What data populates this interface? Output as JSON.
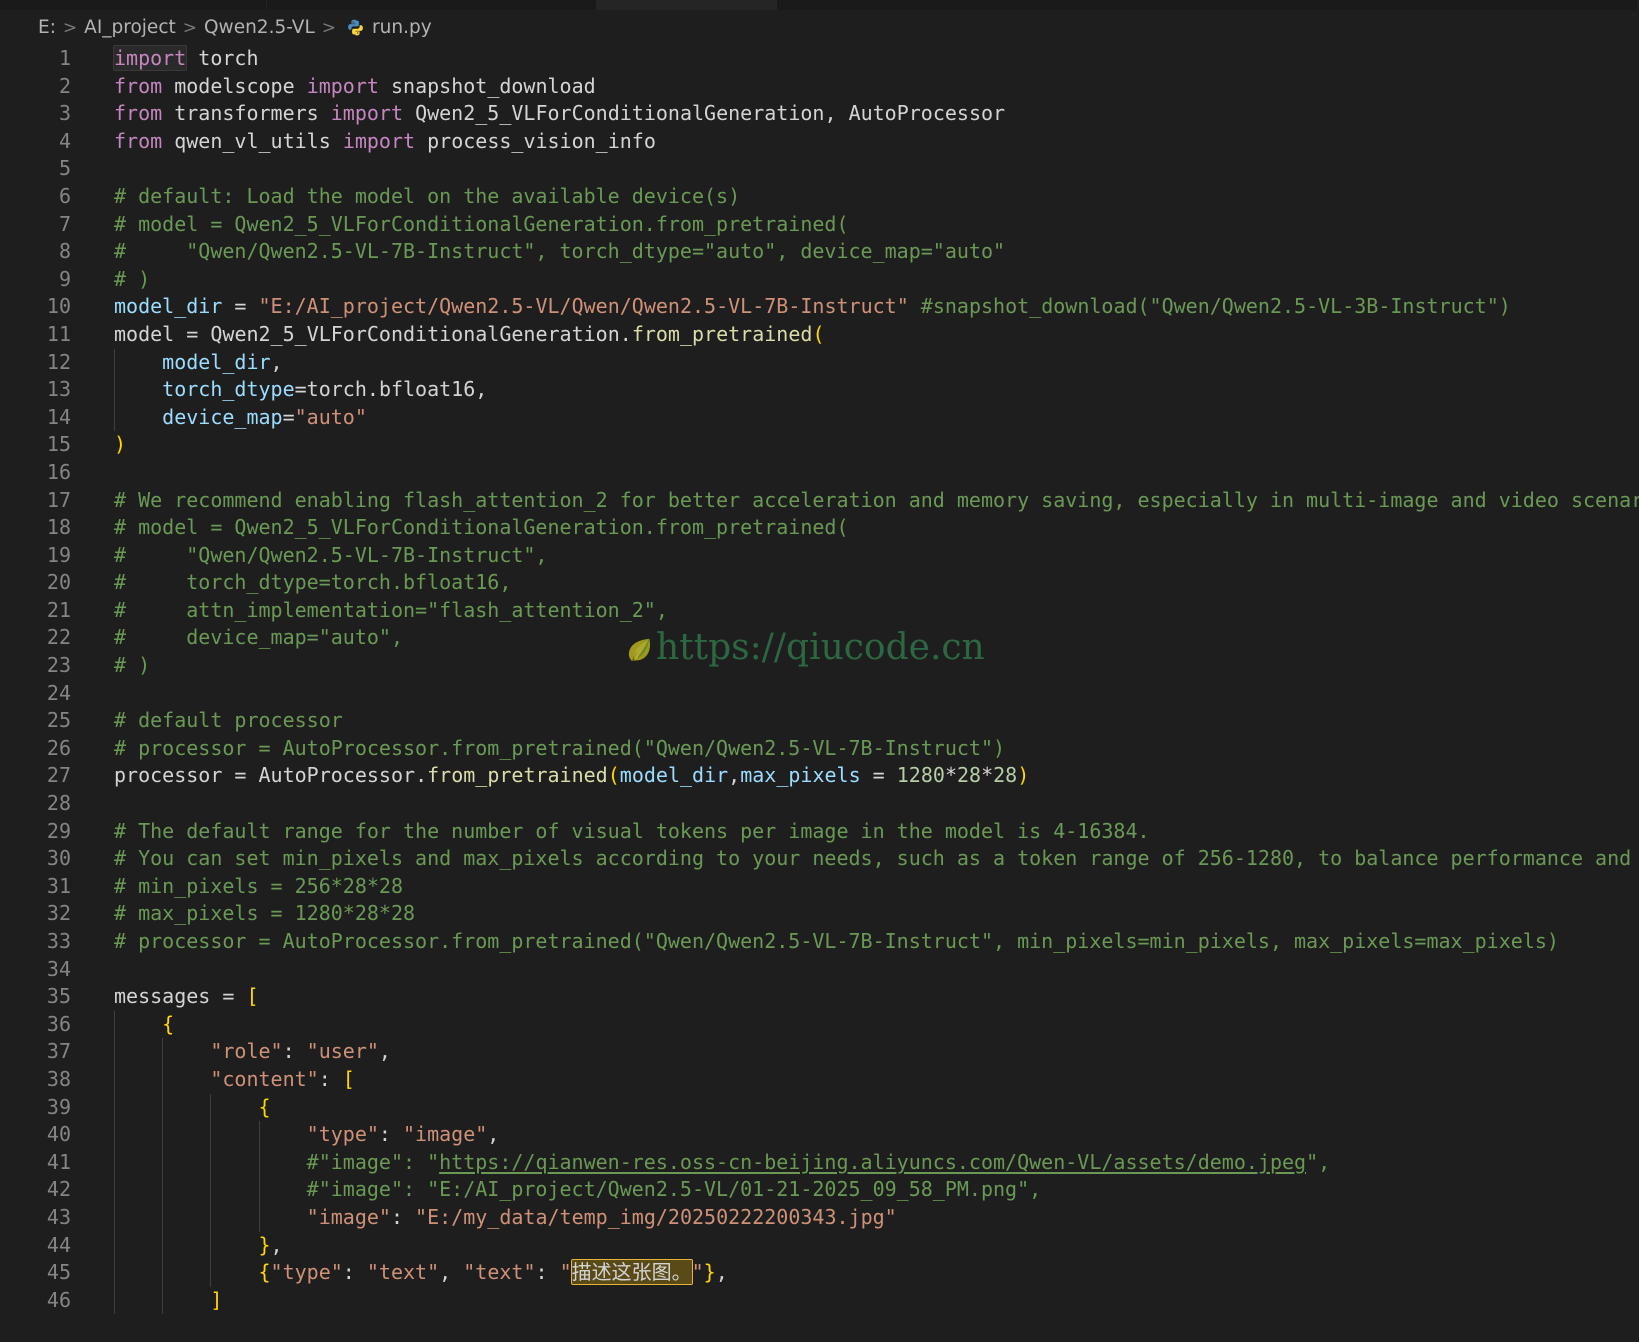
{
  "window": {
    "tabs": [
      {
        "label": "",
        "active": false
      },
      {
        "label": "",
        "active": false
      },
      {
        "label": "",
        "active": true
      },
      {
        "label": "",
        "active": false
      }
    ]
  },
  "breadcrumb": {
    "items": [
      "E:",
      "AI_project",
      "Qwen2.5-VL",
      "run.py"
    ],
    "separator": ">",
    "file_icon": "python-icon",
    "file": "run.py"
  },
  "watermark": {
    "text": "https://qiucode.cn",
    "icon": "leaf-icon",
    "color": "#2e6b44"
  },
  "editor": {
    "language": "python",
    "theme_bg": "#1e1e1e",
    "accent_find_highlight": "#e8b339",
    "find_match_text": "描述这张图。",
    "first_line": 1,
    "last_line": 46,
    "lines": [
      {
        "n": 1,
        "text": "import torch"
      },
      {
        "n": 2,
        "text": "from modelscope import snapshot_download"
      },
      {
        "n": 3,
        "text": "from transformers import Qwen2_5_VLForConditionalGeneration, AutoProcessor"
      },
      {
        "n": 4,
        "text": "from qwen_vl_utils import process_vision_info"
      },
      {
        "n": 5,
        "text": ""
      },
      {
        "n": 6,
        "text": "# default: Load the model on the available device(s)"
      },
      {
        "n": 7,
        "text": "# model = Qwen2_5_VLForConditionalGeneration.from_pretrained("
      },
      {
        "n": 8,
        "text": "#     \"Qwen/Qwen2.5-VL-7B-Instruct\", torch_dtype=\"auto\", device_map=\"auto\""
      },
      {
        "n": 9,
        "text": "# )"
      },
      {
        "n": 10,
        "text": "model_dir = \"E:/AI_project/Qwen2.5-VL/Qwen/Qwen2.5-VL-7B-Instruct\" #snapshot_download(\"Qwen/Qwen2.5-VL-3B-Instruct\")"
      },
      {
        "n": 11,
        "text": "model = Qwen2_5_VLForConditionalGeneration.from_pretrained("
      },
      {
        "n": 12,
        "text": "    model_dir,"
      },
      {
        "n": 13,
        "text": "    torch_dtype=torch.bfloat16,"
      },
      {
        "n": 14,
        "text": "    device_map=\"auto\""
      },
      {
        "n": 15,
        "text": ")"
      },
      {
        "n": 16,
        "text": ""
      },
      {
        "n": 17,
        "text": "# We recommend enabling flash_attention_2 for better acceleration and memory saving, especially in multi-image and video scenarios."
      },
      {
        "n": 18,
        "text": "# model = Qwen2_5_VLForConditionalGeneration.from_pretrained("
      },
      {
        "n": 19,
        "text": "#     \"Qwen/Qwen2.5-VL-7B-Instruct\","
      },
      {
        "n": 20,
        "text": "#     torch_dtype=torch.bfloat16,"
      },
      {
        "n": 21,
        "text": "#     attn_implementation=\"flash_attention_2\","
      },
      {
        "n": 22,
        "text": "#     device_map=\"auto\","
      },
      {
        "n": 23,
        "text": "# )"
      },
      {
        "n": 24,
        "text": ""
      },
      {
        "n": 25,
        "text": "# default processor"
      },
      {
        "n": 26,
        "text": "# processor = AutoProcessor.from_pretrained(\"Qwen/Qwen2.5-VL-7B-Instruct\")"
      },
      {
        "n": 27,
        "text": "processor = AutoProcessor.from_pretrained(model_dir,max_pixels = 1280*28*28)"
      },
      {
        "n": 28,
        "text": ""
      },
      {
        "n": 29,
        "text": "# The default range for the number of visual tokens per image in the model is 4-16384."
      },
      {
        "n": 30,
        "text": "# You can set min_pixels and max_pixels according to your needs, such as a token range of 256-1280, to balance performance and cost."
      },
      {
        "n": 31,
        "text": "# min_pixels = 256*28*28"
      },
      {
        "n": 32,
        "text": "# max_pixels = 1280*28*28"
      },
      {
        "n": 33,
        "text": "# processor = AutoProcessor.from_pretrained(\"Qwen/Qwen2.5-VL-7B-Instruct\", min_pixels=min_pixels, max_pixels=max_pixels)"
      },
      {
        "n": 34,
        "text": ""
      },
      {
        "n": 35,
        "text": "messages = ["
      },
      {
        "n": 36,
        "text": "    {"
      },
      {
        "n": 37,
        "text": "        \"role\": \"user\","
      },
      {
        "n": 38,
        "text": "        \"content\": ["
      },
      {
        "n": 39,
        "text": "            {"
      },
      {
        "n": 40,
        "text": "                \"type\": \"image\","
      },
      {
        "n": 41,
        "text": "                #\"image\": \"https://qianwen-res.oss-cn-beijing.aliyuncs.com/Qwen-VL/assets/demo.jpeg\","
      },
      {
        "n": 42,
        "text": "                #\"image\": \"E:/AI_project/Qwen2.5-VL/01-21-2025_09_58_PM.png\","
      },
      {
        "n": 43,
        "text": "                \"image\": \"E:/my_data/temp_img/20250222200343.jpg\""
      },
      {
        "n": 44,
        "text": "            },"
      },
      {
        "n": 45,
        "text": "            {\"type\": \"text\", \"text\": \"描述这张图。\"},"
      },
      {
        "n": 46,
        "text": "        ]"
      }
    ]
  }
}
